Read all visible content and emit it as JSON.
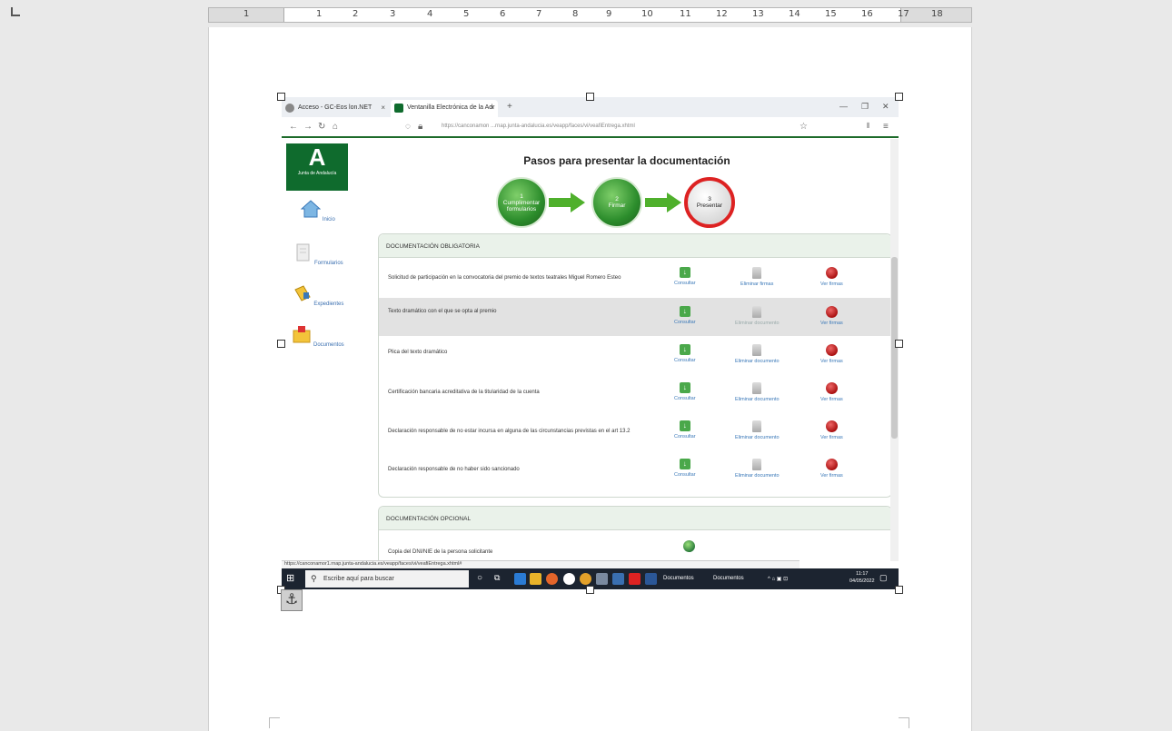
{
  "ruler": {
    "numbers": [
      "1",
      "1",
      "2",
      "3",
      "4",
      "5",
      "6",
      "7",
      "8",
      "9",
      "10",
      "11",
      "12",
      "13",
      "14",
      "15",
      "16",
      "17",
      "18"
    ]
  },
  "browser": {
    "tabs": [
      {
        "label": "Acceso - GC-Eos lon.NET",
        "close": "×"
      },
      {
        "label": "Ventanilla Electrónica de la Adr",
        "close": "×"
      }
    ],
    "new_tab": "+",
    "url": "https://canconamon ...rnap.junta-andalucia.es/veapp/faces/vi/veafiEntrega.xhtml",
    "status_url": "https://canconamor1.rnap.junta-andalucia.es/veapp/faces/vi/veafiEntrega.xhtml#"
  },
  "sidebar": {
    "logo_letter": "A",
    "logo_text": "Junta de Andalucía",
    "items": [
      {
        "label": "Inicio",
        "icon": "home-icon"
      },
      {
        "label": "Formularios",
        "icon": "forms-icon"
      },
      {
        "label": "Expedientes",
        "icon": "folder-icon"
      },
      {
        "label": "Documentos",
        "icon": "documents-icon"
      }
    ]
  },
  "steps": {
    "title": "Pasos para presentar la documentación",
    "items": [
      {
        "num": "1",
        "label": "Cumplimentar formularios"
      },
      {
        "num": "2",
        "label": "Firmar"
      },
      {
        "num": "3",
        "label": "Presentar"
      }
    ]
  },
  "mandatory": {
    "heading": "DOCUMENTACIÓN OBLIGATORIA",
    "rows": [
      {
        "name": "Solicitud de participación en la convocatoria del premio de textos teatrales Miguel Romero Esteo",
        "consult": "Consultar",
        "delete": "Eliminar firmas",
        "signatures": "Ver firmas"
      },
      {
        "name": "Texto dramático con el que se opta al premio",
        "consult": "Consultar",
        "delete": "Eliminar documento",
        "signatures": "Ver firmas"
      },
      {
        "name": "Plica del texto dramático",
        "consult": "Consultar",
        "delete": "Eliminar documento",
        "signatures": "Ver firmas"
      },
      {
        "name": "Certificación bancaria acreditativa de la titularidad de la cuenta",
        "consult": "Consultar",
        "delete": "Eliminar documento",
        "signatures": "Ver firmas"
      },
      {
        "name": "Declaración responsable de no estar incursa en alguna de las circunstancias previstas en el art 13.2",
        "consult": "Consultar",
        "delete": "Eliminar documento",
        "signatures": "Ver firmas"
      },
      {
        "name": "Declaración responsable de no haber sido sancionado",
        "consult": "Consultar",
        "delete": "Eliminar documento",
        "signatures": "Ver firmas"
      }
    ]
  },
  "optional": {
    "heading": "DOCUMENTACIÓN OPCIONAL",
    "rows": [
      {
        "name": "Copia del DNI/NIE de la persona solicitante"
      }
    ]
  },
  "taskbar": {
    "search_placeholder": "Escribe aquí para buscar",
    "item1": "Documentos",
    "item2": "Documentos",
    "time": "11:17",
    "date": "04/05/2022"
  },
  "colors": {
    "brand_green": "#0f6b2d",
    "step_current_ring": "#d22222",
    "link_blue": "#3a78b8"
  }
}
